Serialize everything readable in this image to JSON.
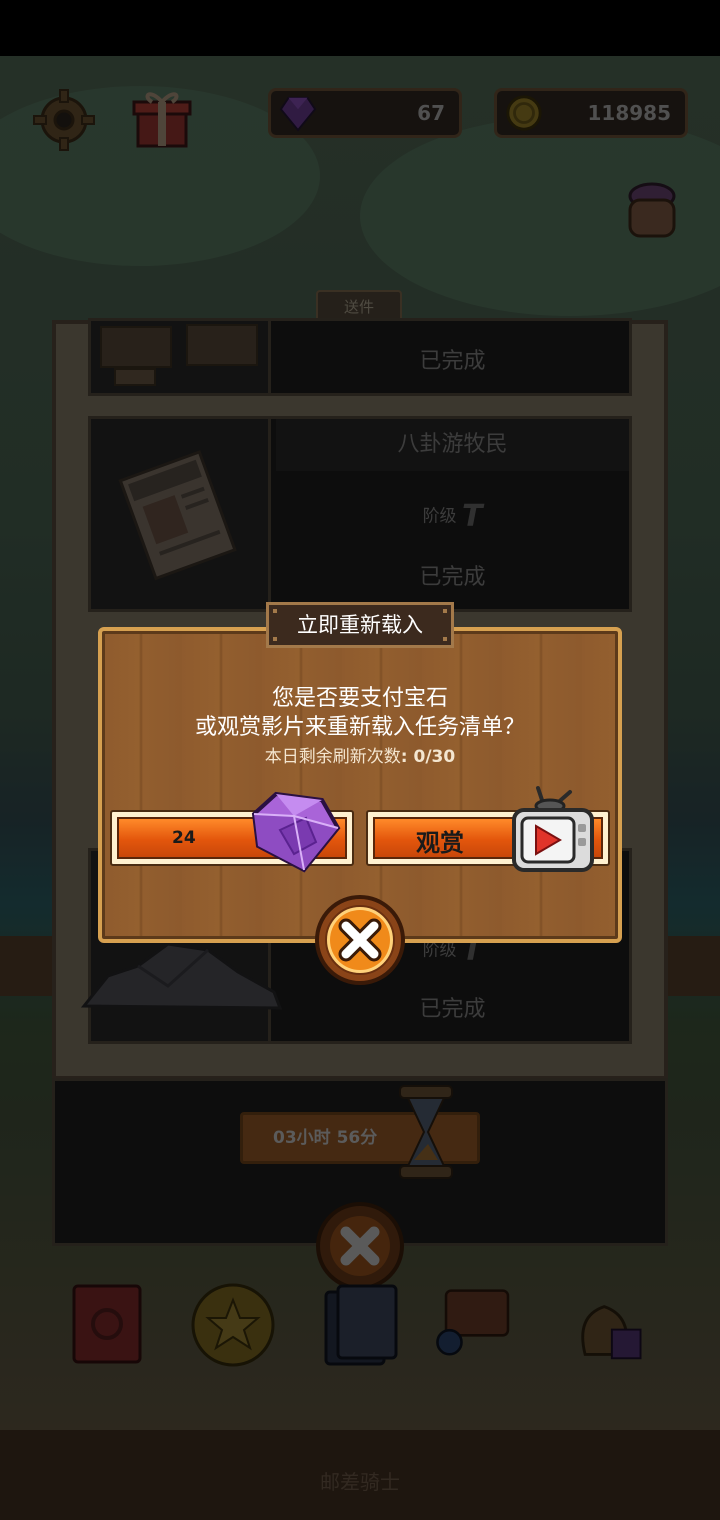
{
  "header": {
    "gems": "67",
    "coins": "118985"
  },
  "panel": {
    "tab_label": "送件",
    "quests": [
      {
        "name": "",
        "status": "已完成",
        "tier_label": ""
      },
      {
        "name": "八卦游牧民",
        "tier_label": "阶级",
        "status": "已完成"
      },
      {
        "name": "",
        "tier_label": "阶级",
        "status": "已完成"
      }
    ],
    "timer": "03小时 56分"
  },
  "dialog": {
    "title": "立即重新载入",
    "question_line1": "您是否要支付宝石",
    "question_line2": "或观赏影片来重新载入任务清单？",
    "refresh_label": "本日剩余刷新次数",
    "refresh_count": ": 0/30",
    "gem_cost": "24",
    "watch_label": "观赏"
  },
  "bottom_nav": {
    "title": "邮差骑士"
  },
  "colors": {
    "accent_orange": "#e3560c",
    "dialog_border": "#d6a050",
    "wood": "#8f5b2e"
  },
  "icons": [
    "gear-icon",
    "gift-icon",
    "gem-icon",
    "coin-icon",
    "potion-jar-icon",
    "newspaper-icon",
    "rock-icon",
    "hourglass-icon",
    "close-icon",
    "tv-icon",
    "book-icon",
    "star-coin-icon",
    "card-icon",
    "chest-icon",
    "loot-bag-icon"
  ]
}
